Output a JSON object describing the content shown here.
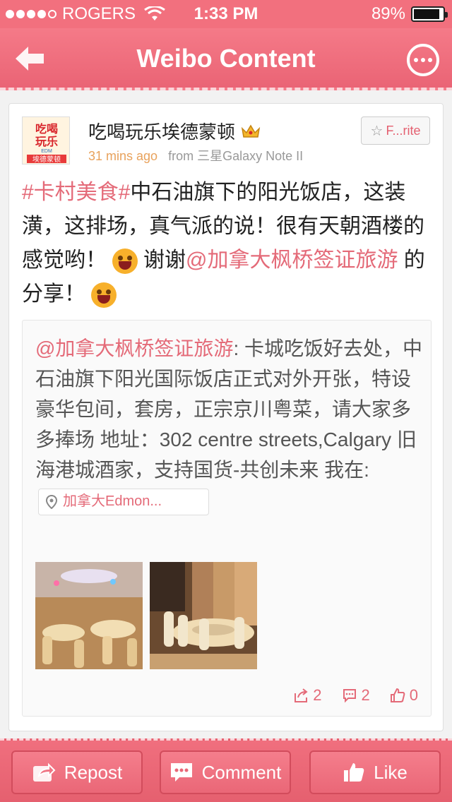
{
  "status_bar": {
    "carrier": "ROGERS",
    "time": "1:33 PM",
    "battery_text": "89%",
    "battery_level": 0.89
  },
  "nav": {
    "title": "Weibo Content"
  },
  "post": {
    "author": "吃喝玩乐埃德蒙顿",
    "avatar_text_top": "吃喝",
    "avatar_text_mid": "玩乐",
    "avatar_text_small": "EDM",
    "avatar_text_bottom": "埃德蒙顿",
    "time_ago": "31 mins ago",
    "source": "from 三星Galaxy Note II",
    "favorite_label": "F...rite",
    "topic": "#卡村美食#",
    "text_1": "中石油旗下的阳光饭店，这装潢，这排场，真气派的说！很有天朝酒楼的感觉哟！",
    "text_2": "谢谢",
    "mention": "@加拿大枫桥签证旅游",
    "text_3": " 的分享！"
  },
  "repost": {
    "mention": "@加拿大枫桥签证旅游",
    "text": ": 卡城吃饭好去处，中石油旗下阳光国际饭店正式对外开张，特设豪华包间，套房，正宗京川粤菜，请大家多多捧场 地址：302 centre streets,Calgary 旧海港城酒家，支持国货-共创未来 我在:",
    "location": "加拿大Edmon...",
    "reposts": "2",
    "comments": "2",
    "likes": "0"
  },
  "toolbar": {
    "repost_label": "Repost",
    "comment_label": "Comment",
    "like_label": "Like"
  },
  "colors": {
    "brand": "#ea6475",
    "link": "#e46a78",
    "time": "#e8a25c"
  }
}
